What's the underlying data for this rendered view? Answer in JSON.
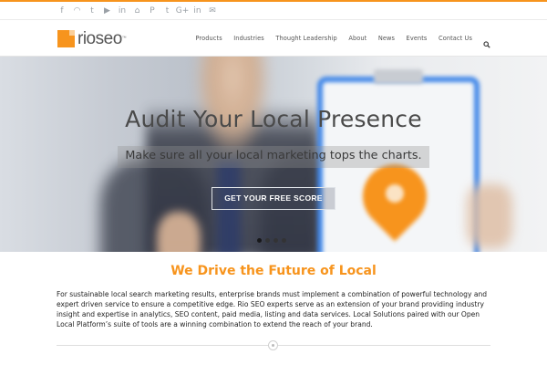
{
  "topbar": {
    "social_icons": [
      "facebook-icon",
      "rss-icon",
      "twitter-icon",
      "youtube-icon",
      "linkedin-box-icon",
      "digg-icon",
      "pinterest-icon",
      "tumblr-icon",
      "google-plus-icon",
      "linkedin-icon",
      "email-icon"
    ],
    "social_glyphs": [
      "f",
      "◠",
      "t",
      "▶",
      "in",
      "⌂",
      "P",
      "t",
      "G+",
      "in",
      "✉"
    ],
    "accent_color": "#f7941d"
  },
  "header": {
    "logo_rio": "rio",
    "logo_seo": "seo",
    "logo_tm": "™",
    "nav": [
      "Products",
      "Industries",
      "Thought Leadership",
      "About",
      "News",
      "Events",
      "Contact Us"
    ],
    "search_icon": "search-icon"
  },
  "hero": {
    "title": "Audit Your Local Presence",
    "subtitle": "Make sure all your local marketing tops the charts.",
    "cta": "GET YOUR FREE SCORE",
    "slide_count": 4,
    "active_slide": 1
  },
  "main": {
    "section_title": "We Drive the Future of Local",
    "intro": "For sustainable local search marketing results, enterprise brands must implement a combination of powerful technology and expert driven service to ensure a competitive edge. Rio SEO experts serve as an extension of your brand providing industry insight and expertise in analytics, SEO content, paid media, listing and data services. Local Solutions paired with our Open Local Platform’s suite of tools are a winning combination to extend the reach of your brand."
  }
}
